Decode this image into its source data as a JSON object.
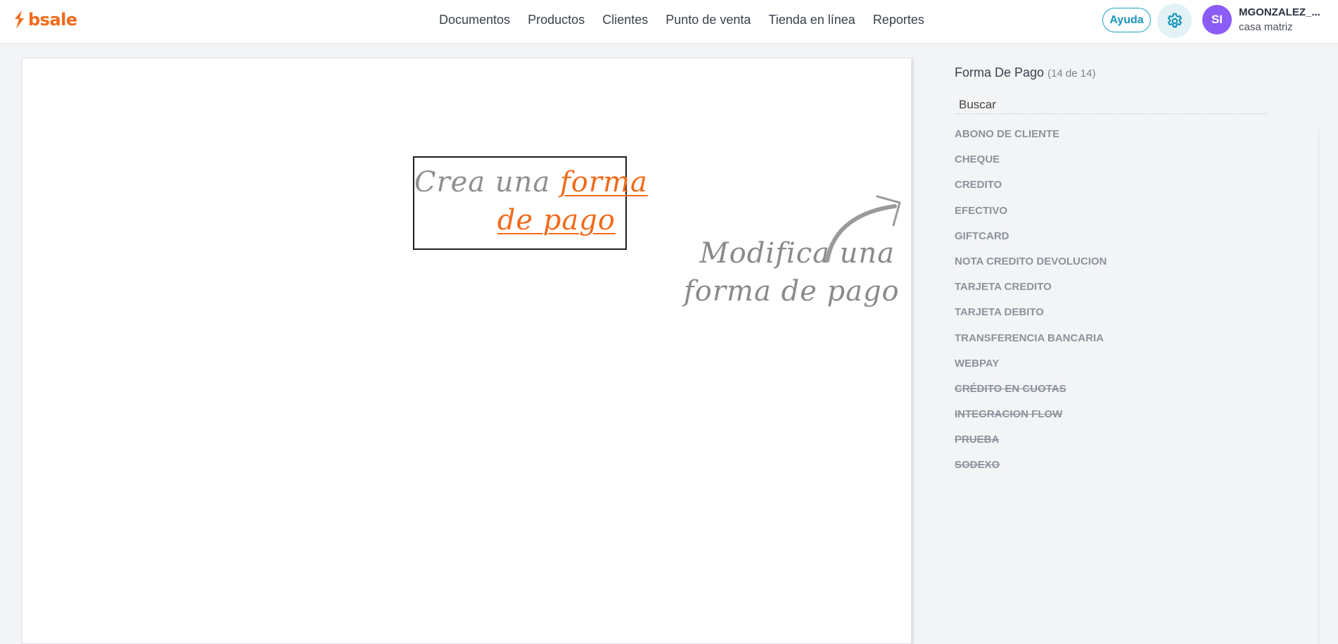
{
  "brand": {
    "name": "bsale",
    "color": "#f26a1b"
  },
  "nav": {
    "items": [
      {
        "label": "Documentos"
      },
      {
        "label": "Productos"
      },
      {
        "label": "Clientes"
      },
      {
        "label": "Punto de venta"
      },
      {
        "label": "Tienda en línea"
      },
      {
        "label": "Reportes"
      }
    ]
  },
  "header": {
    "help_label": "Ayuda",
    "settings_icon": "gear-icon",
    "avatar_initials": "SI",
    "user_name": "MGONZALEZ_...",
    "user_branch": "casa matriz"
  },
  "canvas": {
    "create_hint": {
      "prefix": "Crea una",
      "link1": "forma",
      "link2": "de pago"
    },
    "modify_hint": {
      "line1": "Modifica una",
      "line2": "forma de pago"
    }
  },
  "panel": {
    "title": "Forma De Pago",
    "count": "(14 de 14)",
    "search_placeholder": "Buscar",
    "items": [
      {
        "label": "ABONO DE CLIENTE",
        "active": true
      },
      {
        "label": "CHEQUE",
        "active": true
      },
      {
        "label": "CREDITO",
        "active": true
      },
      {
        "label": "EFECTIVO",
        "active": true
      },
      {
        "label": "GIFTCARD",
        "active": true
      },
      {
        "label": "NOTA CREDITO DEVOLUCION",
        "active": true
      },
      {
        "label": "TARJETA CREDITO",
        "active": true
      },
      {
        "label": "TARJETA DEBITO",
        "active": true
      },
      {
        "label": "TRANSFERENCIA BANCARIA",
        "active": true
      },
      {
        "label": "WEBPAY",
        "active": true
      },
      {
        "label": "CRÉDITO EN CUOTAS",
        "active": false
      },
      {
        "label": "INTEGRACION FLOW",
        "active": false
      },
      {
        "label": "PRUEBA",
        "active": false
      },
      {
        "label": "SODEXO",
        "active": false
      }
    ]
  },
  "colors": {
    "accent": "#f26a1b",
    "help": "#1795bd",
    "avatar": "#8b5cf6",
    "muted_text": "#8d929c"
  }
}
